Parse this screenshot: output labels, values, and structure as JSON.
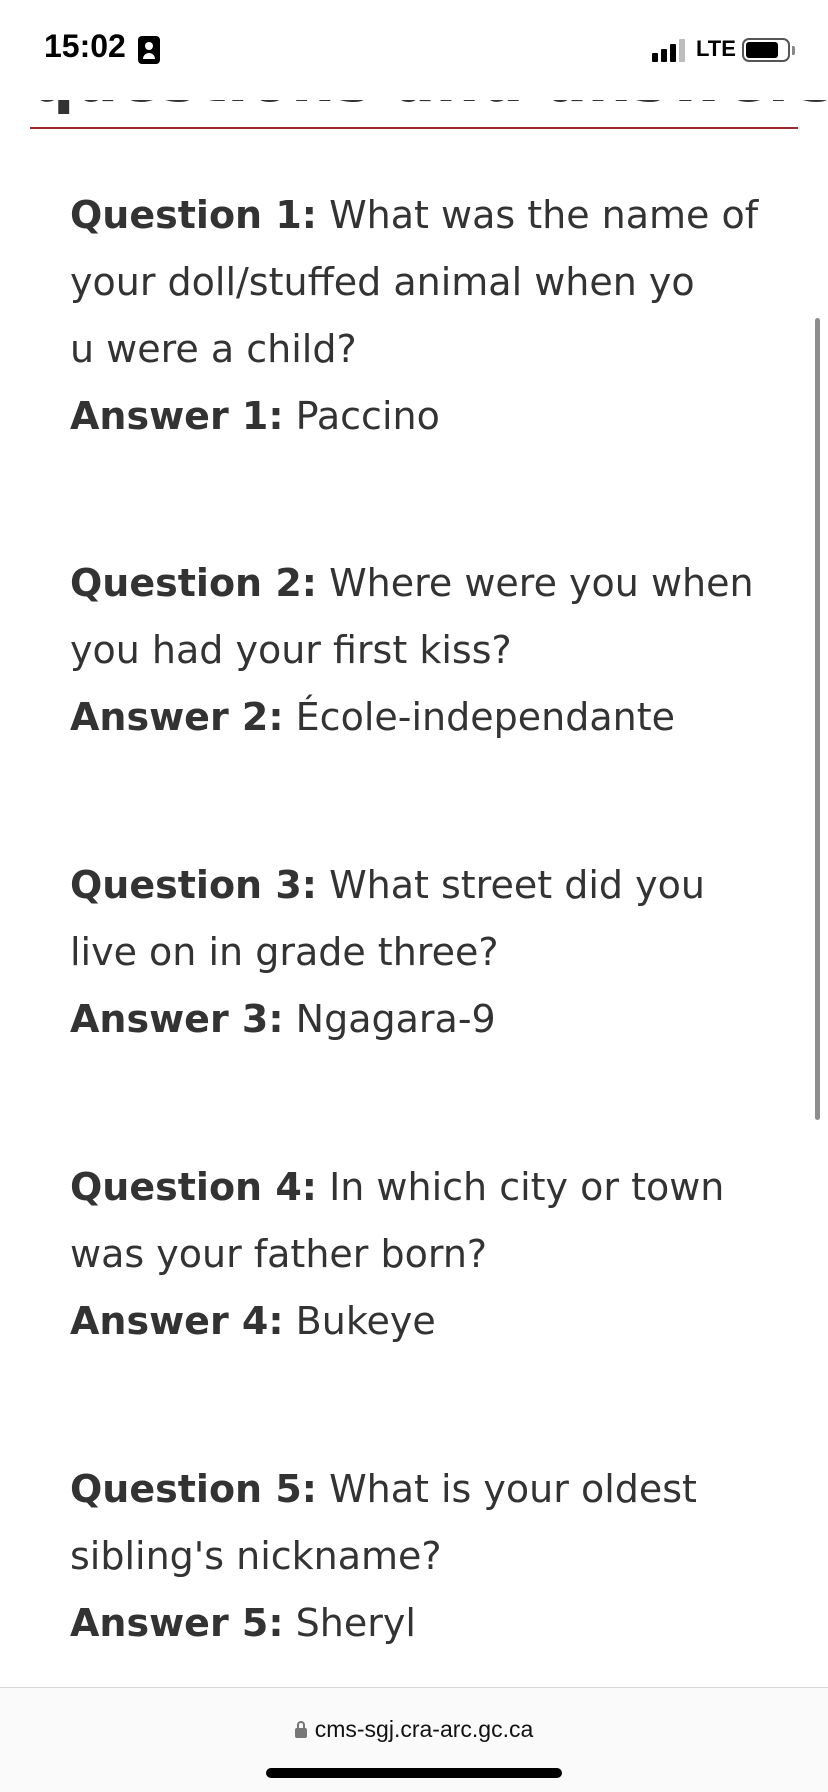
{
  "status_bar": {
    "time": "15:02",
    "network": "LTE",
    "icons": [
      "contact-card-icon",
      "signal-icon",
      "battery-icon"
    ]
  },
  "page": {
    "heading": "questions and answers",
    "items": [
      {
        "question_label": "Question 1:",
        "question_text": "What was the name of your doll/stuffed animal when you were a child?",
        "answer_label": "Answer 1:",
        "answer_text": "Paccino"
      },
      {
        "question_label": "Question 2:",
        "question_text": "Where were you when you had your first kiss?",
        "answer_label": "Answer 2:",
        "answer_text": "École-independante"
      },
      {
        "question_label": "Question 3:",
        "question_text": "What street did you live on in grade three?",
        "answer_label": "Answer 3:",
        "answer_text": "Ngagara-9"
      },
      {
        "question_label": "Question 4:",
        "question_text": "In which city or town was your father born?",
        "answer_label": "Answer 4:",
        "answer_text": "Bukeye"
      },
      {
        "question_label": "Question 5:",
        "question_text": "What is your oldest sibling's nickname?",
        "answer_label": "Answer 5:",
        "answer_text": "Sheryl"
      }
    ]
  },
  "browser": {
    "url": "cms-sgj.cra-arc.gc.ca"
  },
  "colors": {
    "rule": "#a0282d",
    "text": "#333333"
  }
}
